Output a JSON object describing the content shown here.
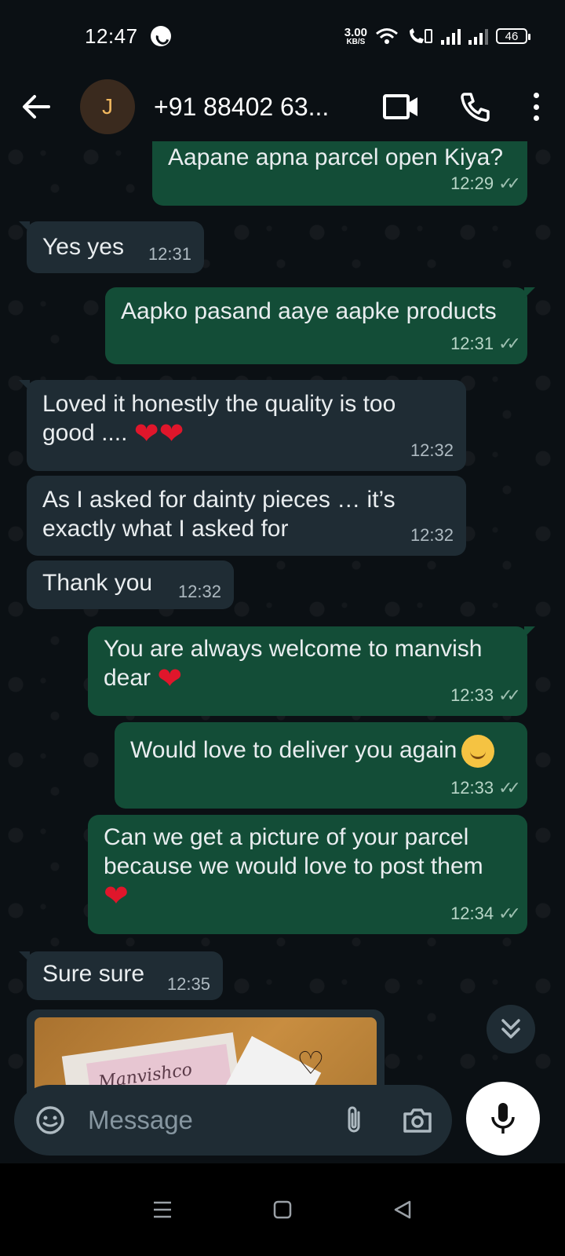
{
  "status_bar": {
    "time": "12:47",
    "speed_value": "3.00",
    "speed_unit": "KB/S",
    "battery": "46"
  },
  "header": {
    "avatar_letter": "J",
    "contact_name": "+91 88402 63..."
  },
  "messages": [
    {
      "id": "m1",
      "direction": "out",
      "text": "Aapane apna parcel open Kiya?",
      "time": "12:29",
      "ticks": "✓✓"
    },
    {
      "id": "m2",
      "direction": "in",
      "text": "Yes yes",
      "time": "12:31"
    },
    {
      "id": "m3",
      "direction": "out",
      "text": "Aapko pasand aaye aapke products",
      "time": "12:31",
      "ticks": "✓✓"
    },
    {
      "id": "m4",
      "direction": "in",
      "text": "Loved it honestly the quality is too good ....",
      "emoji": "❤❤",
      "time": "12:32"
    },
    {
      "id": "m5",
      "direction": "in",
      "text": "As I asked for dainty pieces … it’s exactly what I asked for",
      "time": "12:32"
    },
    {
      "id": "m6",
      "direction": "in",
      "text": "Thank you",
      "time": "12:32"
    },
    {
      "id": "m7",
      "direction": "out",
      "text": "You are always welcome to manvish dear",
      "emoji": "❤",
      "time": "12:33",
      "ticks": "✓✓"
    },
    {
      "id": "m8",
      "direction": "out",
      "text": "Would love to deliver you again",
      "emoji": "smiling-face",
      "time": "12:33",
      "ticks": "✓✓"
    },
    {
      "id": "m9",
      "direction": "out",
      "text": "Can we get a picture of your parcel because we would love to post them",
      "emoji": "❤",
      "time": "12:34",
      "ticks": "✓✓"
    },
    {
      "id": "m10",
      "direction": "in",
      "text": "Sure sure",
      "time": "12:35"
    }
  ],
  "image_message": {
    "card_text": "Manvishco"
  },
  "composer": {
    "placeholder": "Message"
  },
  "colors": {
    "background": "#0b1014",
    "outgoing_bubble": "#134d37",
    "incoming_bubble": "#1f2c34",
    "heart": "#e0162b"
  },
  "icons": [
    "back-arrow-icon",
    "video-call-icon",
    "phone-call-icon",
    "more-options-icon",
    "emoji-sticker-icon",
    "attach-icon",
    "camera-icon",
    "mic-icon",
    "scroll-down-icon",
    "recents-icon",
    "home-icon",
    "back-nav-icon"
  ]
}
